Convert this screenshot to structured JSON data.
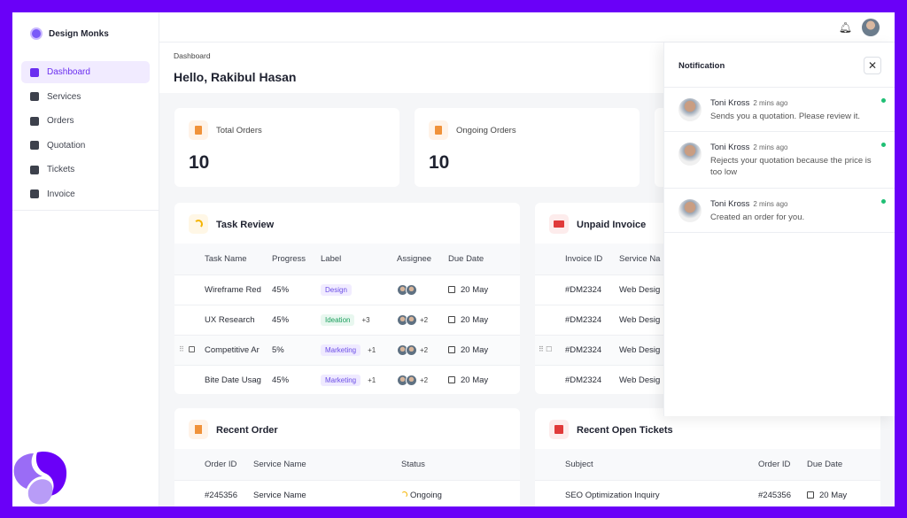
{
  "brand": {
    "name": "Design Monks"
  },
  "sidebar": {
    "items": [
      {
        "label": "Dashboard",
        "icon": "grid-icon",
        "active": true
      },
      {
        "label": "Services",
        "icon": "box-icon"
      },
      {
        "label": "Orders",
        "icon": "list-icon"
      },
      {
        "label": "Quotation",
        "icon": "file-dollar-icon"
      },
      {
        "label": "Tickets",
        "icon": "message-alert-icon"
      },
      {
        "label": "Invoice",
        "icon": "credit-card-icon"
      }
    ]
  },
  "header": {
    "breadcrumb": "Dashboard",
    "greeting": "Hello, Rakibul Hasan"
  },
  "stats": [
    {
      "label": "Total Orders",
      "value": "10"
    },
    {
      "label": "Ongoing Orders",
      "value": "10"
    }
  ],
  "task_review": {
    "title": "Task Review",
    "columns": [
      "Task Name",
      "Progress",
      "Label",
      "Assignee",
      "Due Date"
    ],
    "rows": [
      {
        "name": "Wireframe Red",
        "progress": "45%",
        "label": "Design",
        "label_extra": "",
        "assignee_extra": "",
        "due": "20 May"
      },
      {
        "name": "UX Research",
        "progress": "45%",
        "label": "Ideation",
        "label_extra": "+3",
        "assignee_extra": "+2",
        "due": "20 May"
      },
      {
        "name": "Competitive Ar",
        "progress": "5%",
        "label": "Marketing",
        "label_extra": "+1",
        "assignee_extra": "+2",
        "due": "20 May"
      },
      {
        "name": "Bite Date Usag",
        "progress": "45%",
        "label": "Marketing",
        "label_extra": "+1",
        "assignee_extra": "+2",
        "due": "20 May"
      }
    ]
  },
  "unpaid_invoice": {
    "title": "Unpaid Invoice",
    "columns": [
      "Invoice ID",
      "Service Na"
    ],
    "rows": [
      [
        "#DM2324",
        "Web Desig"
      ],
      [
        "#DM2324",
        "Web Desig"
      ],
      [
        "#DM2324",
        "Web Desig"
      ],
      [
        "#DM2324",
        "Web Desig"
      ]
    ]
  },
  "recent_order": {
    "title": "Recent Order",
    "columns": [
      "Order ID",
      "Service Name",
      "Status"
    ],
    "rows": [
      [
        "#245356",
        "Service Name",
        "Ongoing"
      ]
    ]
  },
  "recent_tickets": {
    "title": "Recent Open Tickets",
    "columns": [
      "Subject",
      "Order ID",
      "Due Date"
    ],
    "rows": [
      [
        "SEO Optimization Inquiry",
        "#245356",
        "20 May"
      ]
    ]
  },
  "notification": {
    "title": "Notification",
    "items": [
      {
        "name": "Toni Kross",
        "time": "2 mins ago",
        "message": "Sends you a quotation. Please review it.",
        "unread": true
      },
      {
        "name": "Toni Kross",
        "time": "2 mins ago",
        "message": "Rejects your quotation because the price is too low",
        "unread": true
      },
      {
        "name": "Toni Kross",
        "time": "2 mins ago",
        "message": "Created an order for you.",
        "unread": true
      }
    ]
  },
  "colors": {
    "frame": "#6a00f8",
    "accent": "#6b2ff0",
    "design_tag": "#6b4de6",
    "ideation_tag": "#1a9e5c",
    "unread_dot": "#1fbf74",
    "invoice_icon": "#e03a3a"
  }
}
